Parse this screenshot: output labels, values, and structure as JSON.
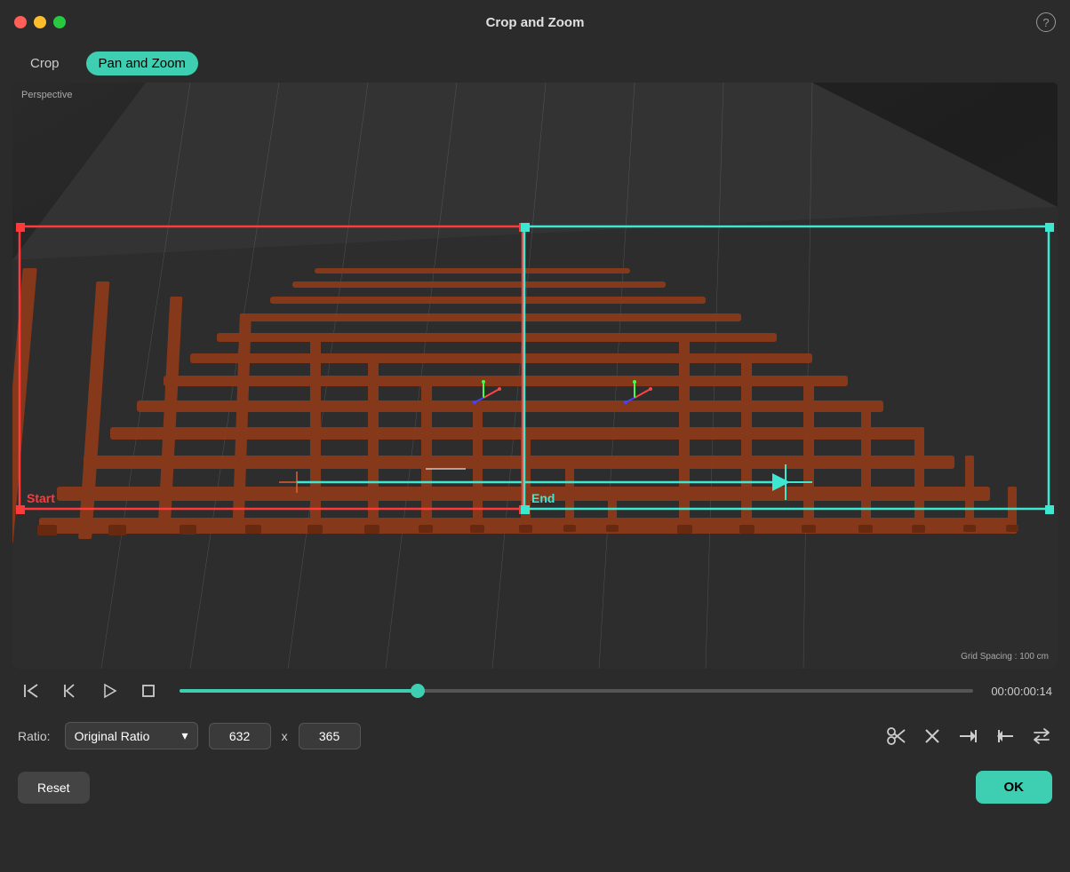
{
  "window": {
    "title": "Crop and Zoom"
  },
  "toolbar": {
    "crop_label": "Crop",
    "pan_zoom_label": "Pan and Zoom"
  },
  "viewport": {
    "perspective_label": "Perspective",
    "grid_spacing_label": "Grid Spacing : 100 cm",
    "start_label": "Start",
    "end_label": "End"
  },
  "transport": {
    "timecode": "00:00:00:14"
  },
  "ratio_bar": {
    "ratio_label": "Ratio:",
    "ratio_value": "Original Ratio",
    "width": "632",
    "height": "365",
    "x_sep": "x"
  },
  "actions": {
    "reset_label": "Reset",
    "ok_label": "OK"
  },
  "help_icon": "?"
}
